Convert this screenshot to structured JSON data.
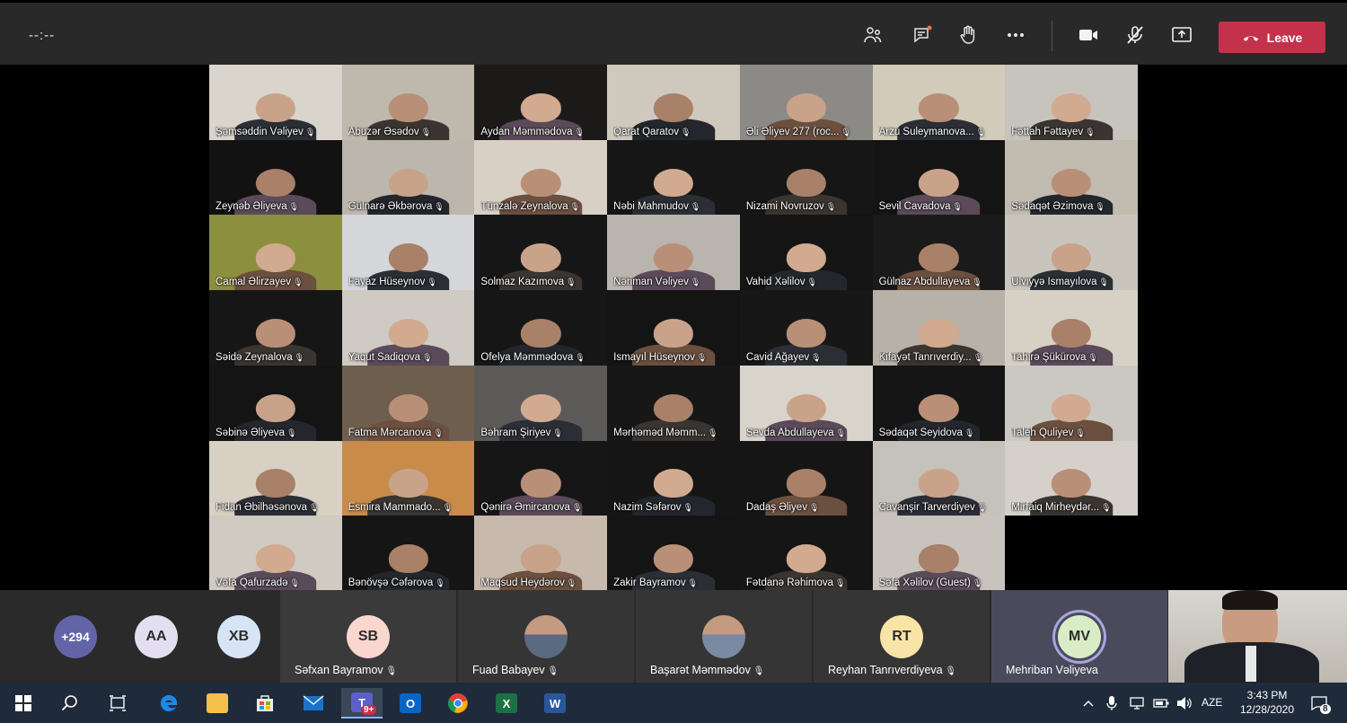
{
  "meeting": {
    "timer": "--:--",
    "leave_label": "Leave"
  },
  "icons": {
    "participants": "people-icon",
    "chat": "chat-icon",
    "raise_hand": "hand-icon",
    "more": "more-icon",
    "camera": "camera-icon",
    "mic": "mic-muted-icon",
    "share": "share-icon",
    "leave": "phone-hangup-icon"
  },
  "colors": {
    "leave": "#c4314b",
    "topbar": "#292929",
    "strip": "#2a2a2a",
    "taskbar": "#1f2b3a"
  },
  "grid": [
    {
      "name": "Şəmsəddin Vəliyev",
      "bg": "#d9d4cc"
    },
    {
      "name": "Abuzər Əsədov",
      "bg": "#bfb8ad"
    },
    {
      "name": "Aydan Məmmədova",
      "bg": "#1c1a18"
    },
    {
      "name": "Qarat Qaratov",
      "bg": "#cfc8bd"
    },
    {
      "name": "Əli Əliyev 277 (roc...",
      "bg": "#8c8a86"
    },
    {
      "name": "Arzu Suleymanova...",
      "bg": "#d2cbb9"
    },
    {
      "name": "Fəttah Fəttayev",
      "bg": "#c7c3bd"
    },
    {
      "name": "Zeynəb Əliyeva",
      "bg": "#121212"
    },
    {
      "name": "Gülnarə Əkbərova",
      "bg": "#bdb6ac"
    },
    {
      "name": "Tünzalə Zeynalova",
      "bg": "#d8d0c5"
    },
    {
      "name": "Nəbi Mahmudov",
      "bg": "#161616"
    },
    {
      "name": "Nizami Novruzov",
      "bg": "#161616"
    },
    {
      "name": "Sevil Cavadova",
      "bg": "#141414"
    },
    {
      "name": "Sədaqət Əzimova",
      "bg": "#c1bbb0"
    },
    {
      "name": "Camal Əlirzayev",
      "bg": "#8c8f3e"
    },
    {
      "name": "Fayaz Hüseynov",
      "bg": "#d4d6da"
    },
    {
      "name": "Solmaz Kazımova",
      "bg": "#161616"
    },
    {
      "name": "Nəriman Vəliyev",
      "bg": "#b9b4ad"
    },
    {
      "name": "Vahid Xəlilov",
      "bg": "#141414"
    },
    {
      "name": "Gülnaz Abdullayeva",
      "bg": "#1a1a1a"
    },
    {
      "name": "Ülviyyə İsmayılova",
      "bg": "#c9c5bd"
    },
    {
      "name": "Səidə Zeynalova",
      "bg": "#161616"
    },
    {
      "name": "Yaqut Sadiqova",
      "bg": "#cfcac3"
    },
    {
      "name": "Ofelya Məmmədova",
      "bg": "#161616"
    },
    {
      "name": "İsmayıl Hüseynov",
      "bg": "#141414"
    },
    {
      "name": "Cavid Ağayev",
      "bg": "#171717"
    },
    {
      "name": "Kifayət Tanrıverdiy...",
      "bg": "#b7b1a8"
    },
    {
      "name": "Tahirə Şükürova",
      "bg": "#d7d1c5"
    },
    {
      "name": "Səbinə Əliyeva",
      "bg": "#141414"
    },
    {
      "name": "Fatma Mərcanova",
      "bg": "#6d5e4d"
    },
    {
      "name": "Bəhram Şiriyev",
      "bg": "#5b5a58"
    },
    {
      "name": "Mərhəməd Məmm...",
      "bg": "#171717"
    },
    {
      "name": "Sevda Abdullayeva",
      "bg": "#d9d4cb"
    },
    {
      "name": "Sədaqət Seyidova",
      "bg": "#151515"
    },
    {
      "name": "Taleh Quliyev",
      "bg": "#cbc7c1"
    },
    {
      "name": "Fidan Əbilhəsənova",
      "bg": "#d8d0c2"
    },
    {
      "name": "Esmira Mammado...",
      "bg": "#c88b4a"
    },
    {
      "name": "Qənirə Əmircanova",
      "bg": "#161616"
    },
    {
      "name": "Nazim Səfərov",
      "bg": "#151515"
    },
    {
      "name": "Dadaş Əliyev",
      "bg": "#151515"
    },
    {
      "name": "Cavanşir Tarverdiyev",
      "bg": "#c5c1bb"
    },
    {
      "name": "Mirfaiq Mirheydər...",
      "bg": "#d5d1ca"
    },
    {
      "name": "Vəfa Qafurzadə",
      "bg": "#cfcac2"
    },
    {
      "name": "Bənövşə Cəfərova",
      "bg": "#151515"
    },
    {
      "name": "Maqsud Heydərov",
      "bg": "#c7b9ab"
    },
    {
      "name": "Zakir Bayramov",
      "bg": "#141414"
    },
    {
      "name": "Fətdanə Rəhimova",
      "bg": "#151515"
    },
    {
      "name": "Səfa Xəlilov (Guest)",
      "bg": "#c8c3bd"
    }
  ],
  "strip": {
    "overflow": [
      {
        "initials": "+294",
        "color": "#6264a7",
        "text_color": "#ffffff"
      },
      {
        "initials": "AA",
        "color": "#e3dff1",
        "text_color": "#2c2c2c"
      },
      {
        "initials": "XB",
        "color": "#d6e4f5",
        "text_color": "#2c2c2c"
      }
    ],
    "people": [
      {
        "name": "Səfxan Bayramov",
        "initials": "SB",
        "color": "#f9d7cf",
        "type": "initials"
      },
      {
        "name": "Fuad Babayev",
        "initials": "",
        "color": "#5a6a80",
        "type": "photo"
      },
      {
        "name": "Başarət Məmmədov",
        "initials": "",
        "color": "#7b8aa3",
        "type": "photo"
      },
      {
        "name": "Reyhan Tanrıverdiyeva",
        "initials": "RT",
        "color": "#f7e4a6",
        "type": "initials"
      },
      {
        "name": "Mehriban Vəliyeva",
        "initials": "MV",
        "color": "#d9ecc6",
        "type": "initials"
      }
    ]
  },
  "taskbar": {
    "language": "AZE",
    "time": "3:43 PM",
    "date": "12/28/2020",
    "teams_badge": "9+",
    "notification_count": "8"
  }
}
